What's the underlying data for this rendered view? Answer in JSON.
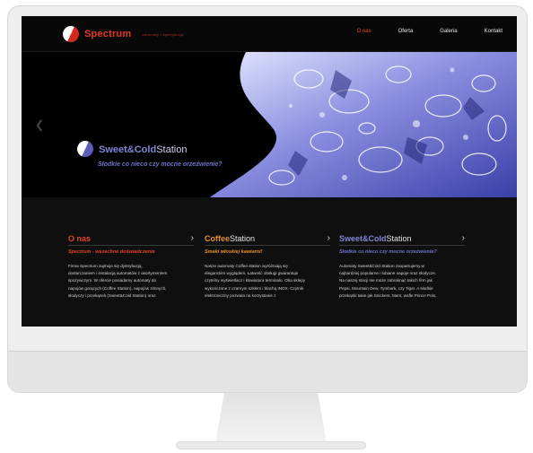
{
  "site": {
    "logo_name": "Spectrum",
    "logo_tagline": "automaty i dystrybucja",
    "menu": [
      {
        "label": "O nas",
        "active": true
      },
      {
        "label": "Oferta",
        "active": false
      },
      {
        "label": "Galeria",
        "active": false
      },
      {
        "label": "Kontakt",
        "active": false
      }
    ]
  },
  "hero": {
    "title_bold": "Sweet&Cold",
    "title_light": "Station",
    "subtitle": "Słodkie co nieco czy mocne orzeźwienie?",
    "prev_icon": "chevron-left-icon"
  },
  "columns": [
    {
      "title_bold": "O nas",
      "title_light": "",
      "title_color": "#e2442b",
      "subtitle": "Spectrum - wszechne doświadczenie",
      "subtitle_color": "#e2442b",
      "lines": [
        "Firma Spectrum zajmuje się dystrybucją,",
        "dostarczaniem i instalacją automatów z asortymentem",
        "spożywczym. W ofercie posiadamy automaty do",
        "napojów gorących (Coffee Station), napojów zimnych,",
        "słodyczy i przekąsek (Sweet&Cold Station) oraz"
      ]
    },
    {
      "title_bold": "Coffee",
      "title_light": "Station",
      "title_color": "#e8902a",
      "subtitle": "Smaki włoskiej kawiarni!",
      "subtitle_color": "#e8902a",
      "lines": [
        "Nasze automaty Coffee station wyróżniają się",
        "eleganckim wyglądem. Łatwość obsługi gwarantuje",
        "czytelny wyświetlacz i klawiatura terminalu. Oba sklepy",
        "wykończone z czarnym szkłem i blachą INOX. Czytnik",
        "elektroniczny pozwala na korzystanie z"
      ]
    },
    {
      "title_bold": "Sweet&Cold",
      "title_light": "Station",
      "title_color": "#7f85d6",
      "subtitle": "Słodkie co nieco czy mocne orzeźwienie?",
      "subtitle_color": "#6e74c8",
      "lines": [
        "Automaty Sweet&Cold Station zaopatrujemy w",
        "najbardziej popularne i lubiane napoje oraz słodycze.",
        "Na naszej stacji nie może zabraknąć takich firm jak",
        "Pepsi, Mountain Dew, Tymbark, czy Tiger. A słodkie",
        "przekąski takie jak Snickers, Mars, wafle Prince Polo,"
      ]
    }
  ]
}
